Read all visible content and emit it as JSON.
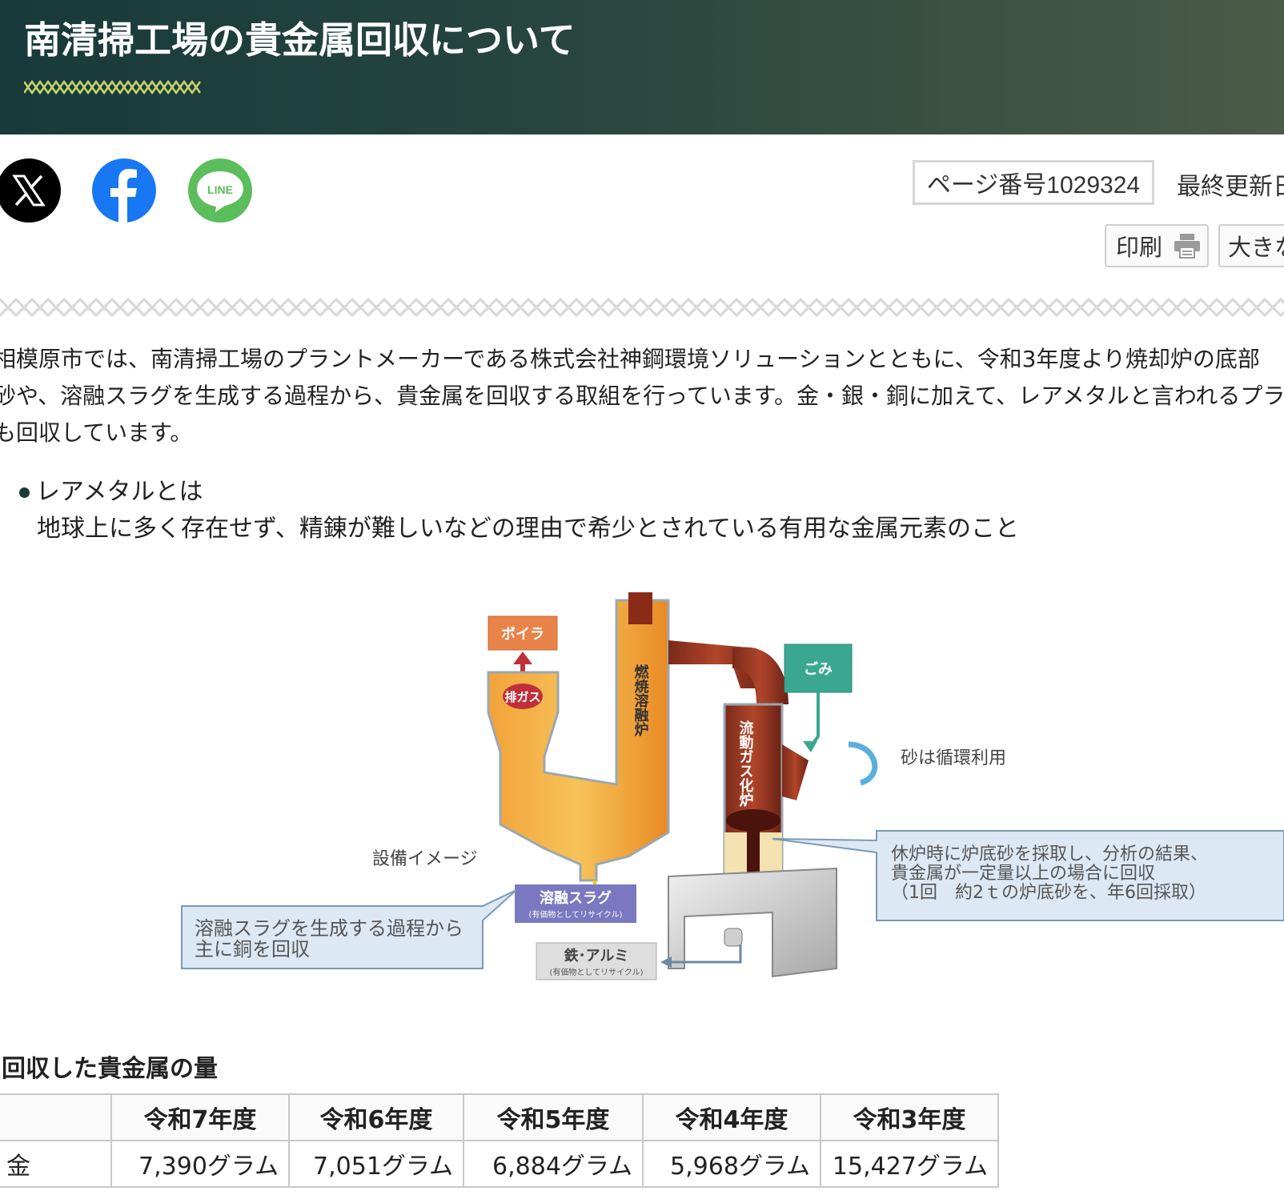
{
  "header": {
    "title": "南清掃工場の貴金属回収について"
  },
  "sns": {
    "x_label": "X",
    "facebook_label": "f",
    "line_label": "LINE"
  },
  "meta": {
    "page_number": "ページ番号1029324",
    "last_updated": "最終更新日"
  },
  "tools": {
    "print_label": "印刷",
    "text_size_label": "大きな"
  },
  "intro": {
    "lines": [
      "相模原市では、南清掃工場のプラントメーカーである株式会社神鋼環境ソリューションとともに、令和3年度より焼却炉の底部",
      "砂や、溶融スラグを生成する過程から、貴金属を回収する取組を行っています。金・銀・銅に加えて、レアメタルと言われるプラ",
      "も回収しています。"
    ]
  },
  "rare_metal": {
    "term": "レアメタルとは",
    "description": "地球上に多く存在せず、精錬が難しいなどの理由で希少とされている有用な金属元素のこと"
  },
  "diagram": {
    "boiler": "ボイラ",
    "exhaust_gas": "排ガス",
    "combustion_furnace": "燃焼溶融炉",
    "gasification_furnace": "流動ガス化炉",
    "garbage": "ごみ",
    "sand_recycle": "砂は循環利用",
    "equipment_image": "設備イメージ",
    "molten_slag": "溶融スラグ",
    "slag_note": "(有価物としてリサイクル)",
    "iron_aluminum": "鉄･アルミ",
    "iron_note": "(有価物としてリサイクル)",
    "callout_left_1": "溶融スラグを生成する過程から",
    "callout_left_2": "主に銅を回収",
    "callout_right_1": "休炉時に炉底砂を採取し、分析の結果、",
    "callout_right_2": "貴金属が一定量以上の場合に回収",
    "callout_right_3": "（1回　約2ｔの炉底砂を、年6回採取）"
  },
  "recovered": {
    "title": "回収した貴金属の量",
    "columns": [
      "",
      "令和7年度",
      "令和6年度",
      "令和5年度",
      "令和4年度",
      "令和3年度"
    ],
    "rows": [
      {
        "label": "金",
        "values": [
          "7,390グラム",
          "7,051グラム",
          "6,884グラム",
          "5,968グラム",
          "15,427グラム"
        ]
      }
    ]
  }
}
